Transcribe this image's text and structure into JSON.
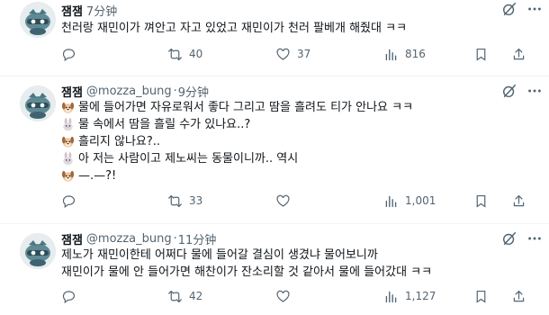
{
  "tweets": [
    {
      "name": "잼잼",
      "handle": "",
      "dot": "·",
      "time": "7分钟",
      "lines": [
        {
          "emoji": "",
          "text": "천러랑 재민이가 껴안고 자고 있었고 재민이가 천러 팔베개 해줬대 ㅋㅋ"
        }
      ],
      "retweets": "40",
      "likes": "37",
      "views": "816"
    },
    {
      "name": "잼잼",
      "handle": "@mozza_bung",
      "dot": "·",
      "time": "9分钟",
      "lines": [
        {
          "emoji": "dog-face",
          "text": "물에 들어가면 자유로워서 좋다 그리고 땀을 흘려도 티가 안나요 ㅋㅋ"
        },
        {
          "emoji": "rabbit-face",
          "text": "물 속에서 땀을 흘릴 수가 있나요..?"
        },
        {
          "emoji": "dog-face",
          "text": "흘리지 않나요?.."
        },
        {
          "emoji": "rabbit-face",
          "text": "아 저는 사람이고 제노씨는 동물이니까.. 역시"
        },
        {
          "emoji": "dog-face",
          "text": "—.—?!"
        }
      ],
      "retweets": "33",
      "likes": "",
      "views": "1,001"
    },
    {
      "name": "잼잼",
      "handle": "@mozza_bung",
      "dot": "·",
      "time": "11分钟",
      "lines": [
        {
          "emoji": "",
          "text": "제노가 재민이한테 어쩌다 물에 들어갈 결심이 생겼냐 물어보니까"
        },
        {
          "emoji": "",
          "text": "재민이가 물에 안 들어가면 해찬이가 잔소리할 것 같아서 물에 들어갔대 ㅋㅋ"
        }
      ],
      "retweets": "42",
      "likes": "",
      "views": "1,127"
    }
  ],
  "icons": {
    "header_left": "grok-slash-icon",
    "header_right": "more-icon",
    "reply": "reply-icon",
    "retweet": "retweet-icon",
    "like": "heart-icon",
    "views": "views-icon"
  },
  "colors": {
    "text": "#0f1419",
    "secondary": "#536471",
    "divider": "#eff3f4"
  }
}
